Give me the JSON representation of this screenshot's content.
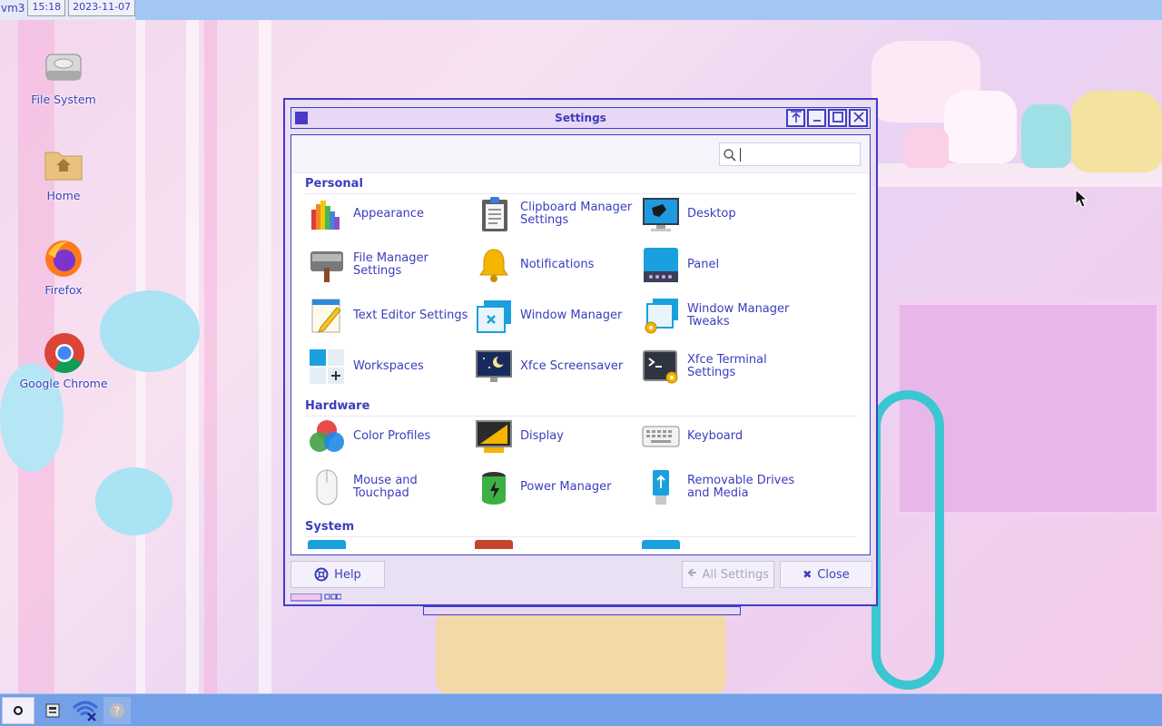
{
  "top_panel": {
    "workspace": "vm3",
    "clock": "15:18",
    "date": "2023-11-07"
  },
  "desktop_icons": [
    {
      "label": "File System",
      "icon": "drive-icon"
    },
    {
      "label": "Home",
      "icon": "home-folder-icon"
    },
    {
      "label": "Firefox",
      "icon": "firefox-icon"
    },
    {
      "label": "Google Chrome",
      "icon": "chrome-icon"
    }
  ],
  "window": {
    "title": "Settings",
    "buttons": [
      "always-on-top",
      "minimize",
      "maximize",
      "close"
    ],
    "search_value": "",
    "categories": [
      {
        "name": "Personal",
        "items": [
          {
            "label": "Appearance",
            "icon": "appearance-icon"
          },
          {
            "label": "Clipboard Manager Settings",
            "icon": "clipboard-icon"
          },
          {
            "label": "Desktop",
            "icon": "desktop-icon"
          },
          {
            "label": "File Manager Settings",
            "icon": "file-manager-icon"
          },
          {
            "label": "Notifications",
            "icon": "bell-icon"
          },
          {
            "label": "Panel",
            "icon": "panel-icon"
          },
          {
            "label": "Text Editor Settings",
            "icon": "text-editor-icon"
          },
          {
            "label": "Window Manager",
            "icon": "window-manager-icon"
          },
          {
            "label": "Window Manager Tweaks",
            "icon": "window-tweaks-icon"
          },
          {
            "label": "Workspaces",
            "icon": "workspaces-icon"
          },
          {
            "label": "Xfce Screensaver",
            "icon": "screensaver-icon"
          },
          {
            "label": "Xfce Terminal Settings",
            "icon": "terminal-icon"
          }
        ]
      },
      {
        "name": "Hardware",
        "items": [
          {
            "label": "Color Profiles",
            "icon": "color-profiles-icon"
          },
          {
            "label": "Display",
            "icon": "display-icon"
          },
          {
            "label": "Keyboard",
            "icon": "keyboard-icon"
          },
          {
            "label": "Mouse and Touchpad",
            "icon": "mouse-icon"
          },
          {
            "label": "Power Manager",
            "icon": "battery-icon"
          },
          {
            "label": "Removable Drives and Media",
            "icon": "usb-drive-icon"
          }
        ]
      },
      {
        "name": "System",
        "items": []
      }
    ],
    "footer": {
      "help": "Help",
      "all_settings": "All Settings",
      "close": "Close"
    }
  },
  "colors": {
    "accent": "#3a3dbd",
    "window_border": "#3c3fc4",
    "top_panel": "#a3c7f3",
    "bottom_panel": "#74a0e8"
  }
}
